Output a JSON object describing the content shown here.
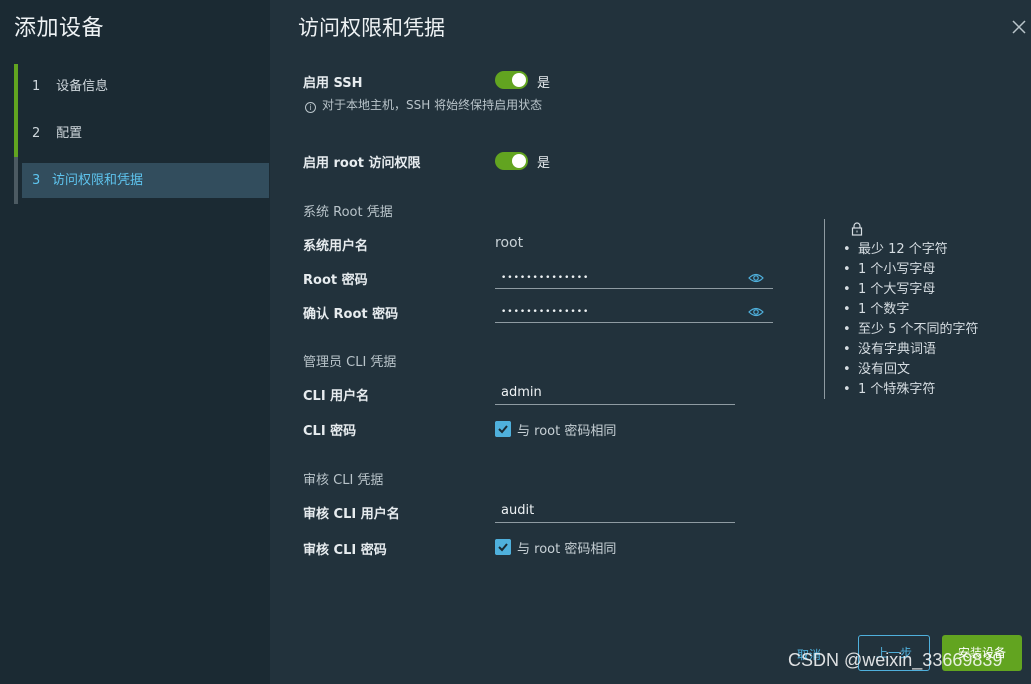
{
  "nav": {
    "title": "添加设备",
    "steps": [
      {
        "num": "1",
        "label": "设备信息"
      },
      {
        "num": "2",
        "label": "配置"
      },
      {
        "num": "3",
        "label": "访问权限和凭据"
      }
    ]
  },
  "main": {
    "title": "访问权限和凭据",
    "ssh": {
      "label": "启用 SSH",
      "state": "是",
      "note": "对于本地主机，SSH 将始终保持启用状态"
    },
    "root_access": {
      "label": "启用 root 访问权限",
      "state": "是"
    },
    "system_root": {
      "section": "系统 Root 凭据",
      "username_label": "系统用户名",
      "username_value": "root",
      "password_label": "Root 密码",
      "password_value": "••••••••••••••",
      "confirm_label": "确认 Root 密码",
      "confirm_value": "••••••••••••••"
    },
    "admin_cli": {
      "section": "管理员 CLI 凭据",
      "username_label": "CLI 用户名",
      "username_value": "admin",
      "password_label": "CLI 密码",
      "same_as_root": "与 root 密码相同"
    },
    "audit_cli": {
      "section": "审核 CLI 凭据",
      "username_label": "审核 CLI 用户名",
      "username_value": "audit",
      "password_label": "审核 CLI 密码",
      "same_as_root": "与 root 密码相同"
    },
    "rules": [
      "最少 12 个字符",
      "1 个小写字母",
      "1 个大写字母",
      "1 个数字",
      "至少 5 个不同的字符",
      "没有字典词语",
      "没有回文",
      "1 个特殊字符"
    ]
  },
  "footer": {
    "cancel": "取消",
    "back": "上一步",
    "install": "安装设备"
  },
  "watermark": "CSDN @weixin_33669839",
  "colors": {
    "accent": "#62a420",
    "link": "#4fb0dc",
    "panel": "#22323c",
    "nav": "#1b2a33"
  }
}
